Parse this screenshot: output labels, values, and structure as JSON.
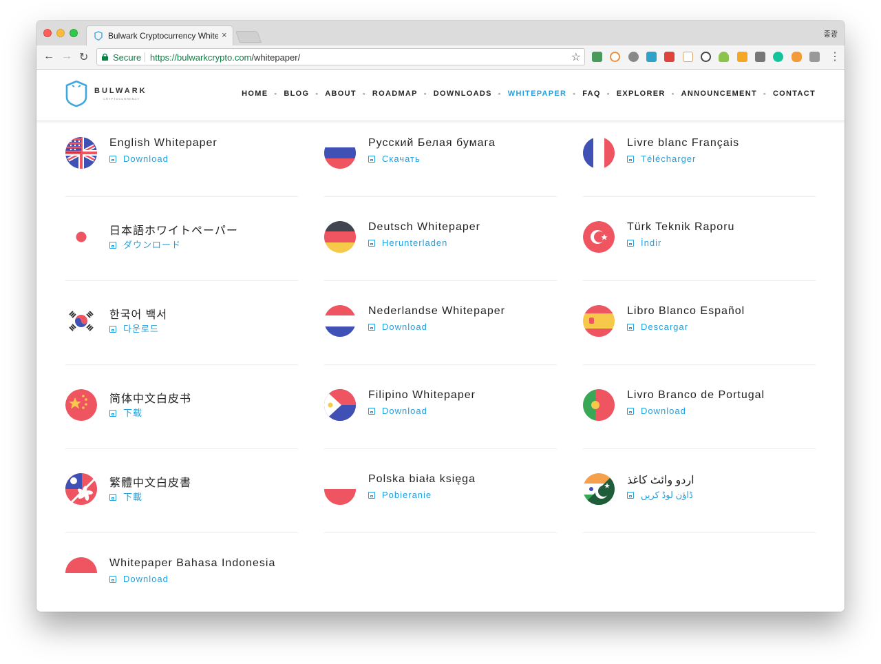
{
  "browser": {
    "tab_title": "Bulwark Cryptocurrency White",
    "tab_close": "×",
    "user_label": "종광",
    "secure_label": "Secure",
    "url_host": "https://bulwarkcrypto.com",
    "url_path": "/whitepaper/"
  },
  "site": {
    "logo_text": "BULWARK",
    "logo_sub": "CRYPTOCURRENCY",
    "nav": [
      "HOME",
      "BLOG",
      "ABOUT",
      "ROADMAP",
      "DOWNLOADS",
      "WHITEPAPER",
      "FAQ",
      "EXPLORER",
      "ANNOUNCEMENT",
      "CONTACT"
    ],
    "nav_active": "WHITEPAPER",
    "nav_separator": "-",
    "accent_color": "#22a0dd"
  },
  "whitepapers": [
    {
      "title": "English Whitepaper",
      "download": "Download",
      "flag": "us-uk-flag-icon"
    },
    {
      "title": "Русский Белая бумага",
      "download": "Скачать",
      "flag": "russia-flag-icon"
    },
    {
      "title": "Livre blanc Français",
      "download": "Télécharger",
      "flag": "france-flag-icon"
    },
    {
      "title": "日本語ホワイトペーパー",
      "download": "ダウンロード",
      "flag": "japan-flag-icon"
    },
    {
      "title": "Deutsch Whitepaper",
      "download": "Herunterladen",
      "flag": "germany-flag-icon"
    },
    {
      "title": "Türk Teknik Raporu",
      "download": "İndir",
      "flag": "turkey-flag-icon"
    },
    {
      "title": "한국어 백서",
      "download": "다운로드",
      "flag": "korea-flag-icon"
    },
    {
      "title": "Nederlandse Whitepaper",
      "download": "Download",
      "flag": "netherlands-flag-icon"
    },
    {
      "title": "Libro Blanco Español",
      "download": "Descargar",
      "flag": "spain-flag-icon"
    },
    {
      "title": "简体中文白皮书",
      "download": "下载",
      "flag": "china-flag-icon"
    },
    {
      "title": "Filipino Whitepaper",
      "download": "Download",
      "flag": "philippines-flag-icon"
    },
    {
      "title": "Livro Branco de Portugal",
      "download": "Download",
      "flag": "portugal-flag-icon"
    },
    {
      "title": "繁體中文白皮書",
      "download": "下載",
      "flag": "taiwan-hongkong-flag-icon"
    },
    {
      "title": "Polska biała księga",
      "download": "Pobieranie",
      "flag": "poland-flag-icon"
    },
    {
      "title": "اردو وائٹ کاغذ",
      "download": "ڈاؤن لوڈ کریں",
      "flag": "india-pakistan-flag-icon"
    },
    {
      "title": "Whitepaper Bahasa Indonesia",
      "download": "Download",
      "flag": "indonesia-flag-icon"
    }
  ]
}
